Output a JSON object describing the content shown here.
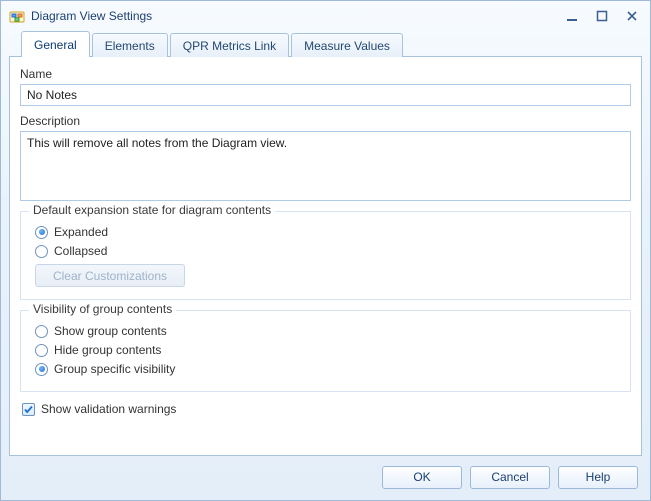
{
  "window": {
    "title": "Diagram View Settings"
  },
  "tabs": [
    {
      "label": "General"
    },
    {
      "label": "Elements"
    },
    {
      "label": "QPR Metrics Link"
    },
    {
      "label": "Measure Values"
    }
  ],
  "general": {
    "name_label": "Name",
    "name_value": "No Notes",
    "description_label": "Description",
    "description_value": "This will remove all notes from the Diagram view."
  },
  "expansion": {
    "legend": "Default expansion state for diagram contents",
    "expanded_label": "Expanded",
    "collapsed_label": "Collapsed",
    "selected": "expanded",
    "clear_button": "Clear Customizations"
  },
  "visibility": {
    "legend": "Visibility of group contents",
    "show_label": "Show group contents",
    "hide_label": "Hide group contents",
    "specific_label": "Group specific visibility",
    "selected": "specific"
  },
  "validation": {
    "label": "Show validation warnings",
    "checked": true
  },
  "buttons": {
    "ok": "OK",
    "cancel": "Cancel",
    "help": "Help"
  }
}
